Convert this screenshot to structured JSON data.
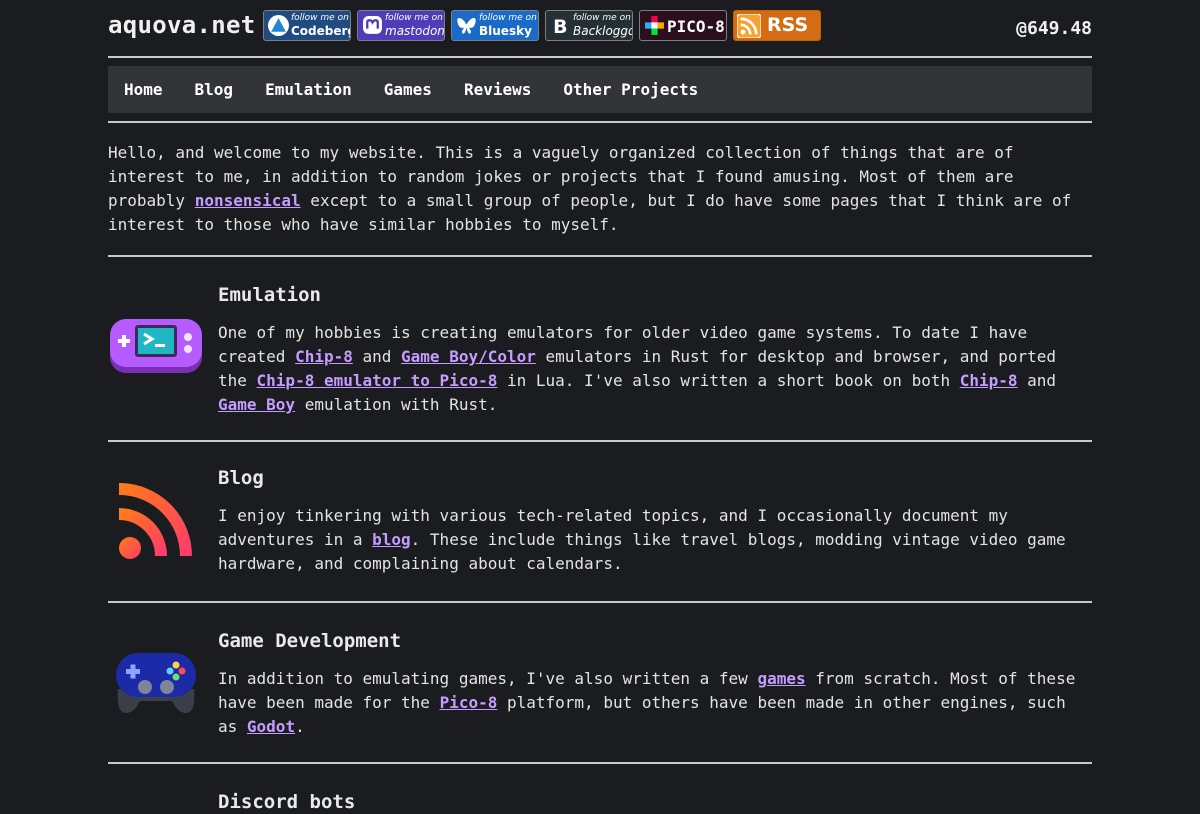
{
  "header": {
    "site_title": "aquova.net",
    "handle": "@649.48",
    "badges": [
      {
        "name": "codeberg",
        "line1": "follow me on",
        "line2": "Codeberg"
      },
      {
        "name": "mastodon",
        "line1": "follow me on",
        "line2": "mastodon"
      },
      {
        "name": "bluesky",
        "line1": "follow me on",
        "line2": "Bluesky"
      },
      {
        "name": "backloggd",
        "line1": "follow me on",
        "line2": "Backloggd"
      },
      {
        "name": "pico8",
        "line1": "",
        "line2": "PICO-8"
      },
      {
        "name": "rss",
        "line1": "",
        "line2": "RSS"
      }
    ]
  },
  "nav": [
    "Home",
    "Blog",
    "Emulation",
    "Games",
    "Reviews",
    "Other Projects"
  ],
  "intro": {
    "before": "Hello, and welcome to my website. This is a vaguely organized collection of things that are of interest to me, in addition to random jokes or projects that I found amusing. Most of them are probably ",
    "link": "nonsensical",
    "after": " except to a small group of people, but I do have some pages that I think are of interest to those who have similar hobbies to myself."
  },
  "sections": [
    {
      "title": "Emulation",
      "icon": "handheld-console-icon",
      "t1": "One of my hobbies is creating emulators for older video game systems. To date I have created ",
      "l1": "Chip-8",
      "t2": " and ",
      "l2": "Game Boy/Color",
      "t3": " emulators in Rust for desktop and browser, and ported the ",
      "l3": "Chip-8 emulator to Pico-8",
      "t4": " in Lua. I've also written a short book on both ",
      "l4": "Chip-8",
      "t5": " and ",
      "l5": "Game Boy",
      "t6": " emulation with Rust."
    },
    {
      "title": "Blog",
      "icon": "rss-feed-icon",
      "t1": "I enjoy tinkering with various tech-related topics, and I occasionally document my adventures in a ",
      "l1": "blog",
      "t2": ". These include things like travel blogs, modding vintage video game hardware, and complaining about calendars."
    },
    {
      "title": "Game Development",
      "icon": "gamepad-icon",
      "t1": "In addition to emulating games, I've also written a few ",
      "l1": "games",
      "t2": " from scratch. Most of these have been made for the ",
      "l2": "Pico-8",
      "t3": " platform, but others have been made in other engines, such as ",
      "l3": "Godot",
      "t4": "."
    },
    {
      "title": "Discord bots"
    }
  ]
}
